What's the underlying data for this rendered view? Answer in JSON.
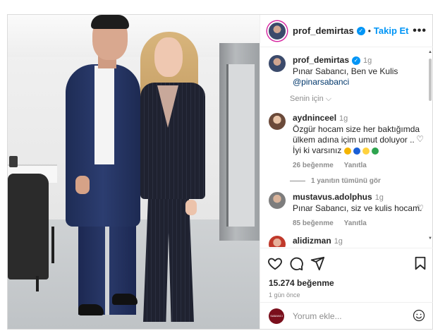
{
  "post": {
    "photo_alt_icon": "post-photo",
    "header": {
      "username": "prof_demirtas",
      "separator": "•",
      "follow_label": "Takip Et",
      "more_label": "•••"
    },
    "caption": {
      "username": "prof_demirtas",
      "time": "1g",
      "text_line1": "Pınar Sabancı, Ben ve Kulis",
      "mention": "@pinarsabanci",
      "see_translation": "Senin için ⌵"
    },
    "comments": [
      {
        "username": "aydninceel",
        "time": "1g",
        "text": "Özgür hocam size her baktığımda ülkem adına içim umut doluyor .. İyi ki varsınız",
        "likes": "26 beğenme",
        "reply": "Yanıtla"
      },
      {
        "username": "mustavus.adolphus",
        "time": "1g",
        "text": "Pınar Sabancı, siz ve kulis hocam.",
        "likes": "85 beğenme",
        "reply": "Yanıtla"
      },
      {
        "username": "alidizman",
        "time": "1g"
      }
    ],
    "view_replies": "1 yanıtın tümünü gör",
    "likes_count": "15.274 beğenme",
    "posted_ago": "1 gün önce",
    "comment_placeholder": "Yorum ekle...",
    "brand_avatar_text": "SABANCI"
  }
}
